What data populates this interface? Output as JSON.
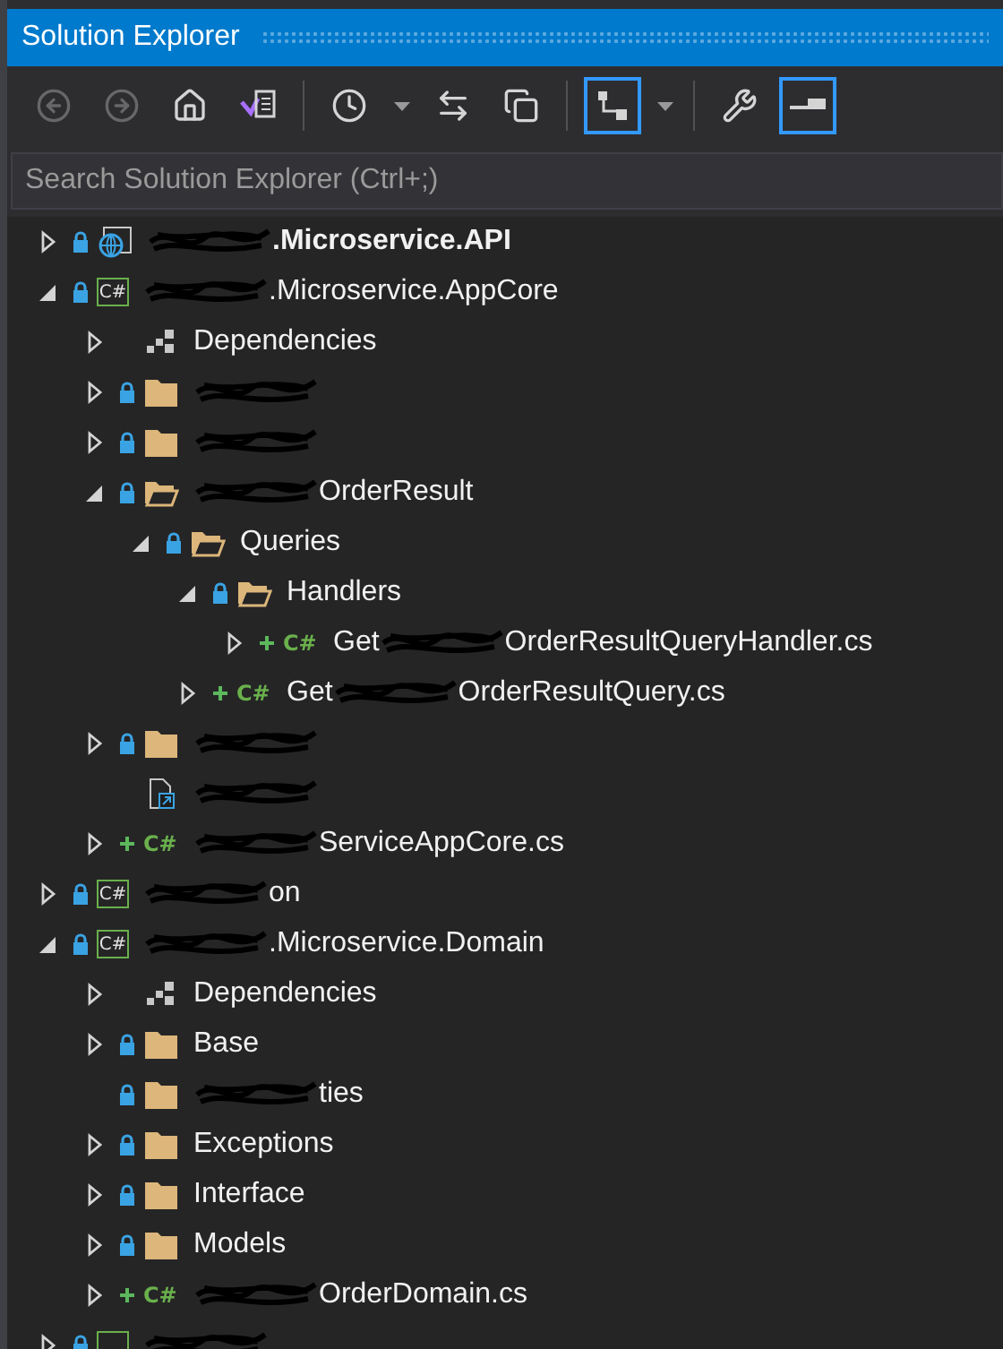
{
  "window": {
    "title": "Solution Explorer"
  },
  "toolbar": [
    {
      "kind": "back",
      "disabled": true,
      "on": false
    },
    {
      "kind": "forward",
      "disabled": true,
      "on": false
    },
    {
      "kind": "home",
      "disabled": false,
      "on": false
    },
    {
      "kind": "switch-views",
      "disabled": false,
      "on": false
    },
    {
      "kind": "separator"
    },
    {
      "kind": "pending-changes",
      "disabled": false,
      "on": false
    },
    {
      "kind": "dropdown"
    },
    {
      "kind": "sync",
      "disabled": false,
      "on": false
    },
    {
      "kind": "collapse",
      "disabled": false,
      "on": false
    },
    {
      "kind": "separator"
    },
    {
      "kind": "show-all",
      "disabled": false,
      "on": true
    },
    {
      "kind": "dropdown"
    },
    {
      "kind": "separator"
    },
    {
      "kind": "properties",
      "disabled": false,
      "on": false
    },
    {
      "kind": "preview",
      "disabled": false,
      "on": true
    }
  ],
  "search": {
    "placeholder": "Search Solution Explorer (Ctrl+;)"
  },
  "tree": [
    {
      "kind": "web-project",
      "expanded": false,
      "locked": true,
      "added": false,
      "bold": true,
      "parts": [
        {
          "kind": "scribble"
        },
        {
          "kind": "text",
          "text": ".Microservice.API"
        }
      ]
    },
    {
      "kind": "cs-project",
      "icon_text": "C#",
      "expanded": true,
      "locked": true,
      "added": false,
      "bold": false,
      "parts": [
        {
          "kind": "scribble"
        },
        {
          "kind": "text",
          "text": ".Microservice.AppCore"
        }
      ],
      "children": [
        {
          "kind": "dependencies",
          "expanded": false,
          "locked": false,
          "added": false,
          "bold": false,
          "parts": [
            {
              "kind": "text",
              "text": "Dependencies"
            }
          ]
        },
        {
          "kind": "folder",
          "expanded": false,
          "locked": true,
          "added": false,
          "parts": [
            {
              "kind": "scribble"
            }
          ]
        },
        {
          "kind": "folder",
          "expanded": false,
          "locked": true,
          "added": false,
          "parts": [
            {
              "kind": "scribble"
            }
          ]
        },
        {
          "kind": "folder",
          "expanded": true,
          "locked": true,
          "added": false,
          "bold": false,
          "parts": [
            {
              "kind": "scribble"
            },
            {
              "kind": "text",
              "text": "OrderResult"
            }
          ],
          "children": [
            {
              "kind": "folder",
              "expanded": true,
              "locked": true,
              "added": false,
              "bold": false,
              "parts": [
                {
                  "kind": "text",
                  "text": "Queries"
                }
              ],
              "children": [
                {
                  "kind": "folder",
                  "expanded": true,
                  "locked": true,
                  "added": false,
                  "bold": false,
                  "parts": [
                    {
                      "kind": "text",
                      "text": "Handlers"
                    }
                  ],
                  "children": [
                    {
                      "kind": "cs-file",
                      "icon_text": "C#",
                      "expanded": false,
                      "locked": false,
                      "added": true,
                      "bold": false,
                      "parts": [
                        {
                          "kind": "text",
                          "text": "Get"
                        },
                        {
                          "kind": "scribble"
                        },
                        {
                          "kind": "text",
                          "text": "OrderResultQueryHandler.cs"
                        }
                      ]
                    }
                  ]
                },
                {
                  "kind": "cs-file",
                  "icon_text": "C#",
                  "expanded": false,
                  "locked": false,
                  "added": true,
                  "bold": false,
                  "parts": [
                    {
                      "kind": "text",
                      "text": "Get"
                    },
                    {
                      "kind": "scribble"
                    },
                    {
                      "kind": "text",
                      "text": "OrderResultQuery.cs"
                    }
                  ]
                }
              ]
            }
          ]
        },
        {
          "kind": "folder",
          "expanded": false,
          "locked": true,
          "added": false,
          "parts": [
            {
              "kind": "scribble"
            }
          ]
        },
        {
          "kind": "link-file",
          "locked": false,
          "added": false,
          "parts": [
            {
              "kind": "scribble"
            }
          ]
        },
        {
          "kind": "cs-file",
          "icon_text": "C#",
          "expanded": false,
          "locked": false,
          "added": true,
          "bold": false,
          "parts": [
            {
              "kind": "scribble"
            },
            {
              "kind": "text",
              "text": "ServiceAppCore.cs"
            }
          ]
        }
      ]
    },
    {
      "kind": "cs-project",
      "icon_text": "C#",
      "expanded": false,
      "locked": true,
      "added": false,
      "bold": false,
      "parts": [
        {
          "kind": "scribble"
        },
        {
          "kind": "text",
          "text": "on"
        }
      ]
    },
    {
      "kind": "cs-project",
      "icon_text": "C#",
      "expanded": true,
      "locked": true,
      "added": false,
      "bold": false,
      "parts": [
        {
          "kind": "scribble"
        },
        {
          "kind": "text",
          "text": ".Microservice.Domain"
        }
      ],
      "children": [
        {
          "kind": "dependencies",
          "expanded": false,
          "locked": false,
          "added": false,
          "bold": false,
          "parts": [
            {
              "kind": "text",
              "text": "Dependencies"
            }
          ]
        },
        {
          "kind": "folder",
          "expanded": false,
          "locked": true,
          "added": false,
          "bold": false,
          "parts": [
            {
              "kind": "text",
              "text": "Base"
            }
          ]
        },
        {
          "kind": "folder",
          "locked": true,
          "added": false,
          "bold": false,
          "parts": [
            {
              "kind": "scribble"
            },
            {
              "kind": "text",
              "text": "ties"
            }
          ]
        },
        {
          "kind": "folder",
          "expanded": false,
          "locked": true,
          "added": false,
          "bold": false,
          "parts": [
            {
              "kind": "text",
              "text": "Exceptions"
            }
          ]
        },
        {
          "kind": "folder",
          "expanded": false,
          "locked": true,
          "added": false,
          "bold": false,
          "parts": [
            {
              "kind": "text",
              "text": "Interface"
            }
          ]
        },
        {
          "kind": "folder",
          "expanded": false,
          "locked": true,
          "added": false,
          "bold": false,
          "parts": [
            {
              "kind": "text",
              "text": "Models"
            }
          ]
        },
        {
          "kind": "cs-file",
          "icon_text": "C#",
          "expanded": false,
          "locked": false,
          "added": true,
          "bold": false,
          "parts": [
            {
              "kind": "scribble"
            },
            {
              "kind": "text",
              "text": "OrderDomain.cs"
            }
          ]
        }
      ]
    },
    {
      "kind": "cs-project",
      "expanded": false,
      "locked": true,
      "added": false,
      "parts": [
        {
          "kind": "scribble"
        }
      ]
    }
  ]
}
